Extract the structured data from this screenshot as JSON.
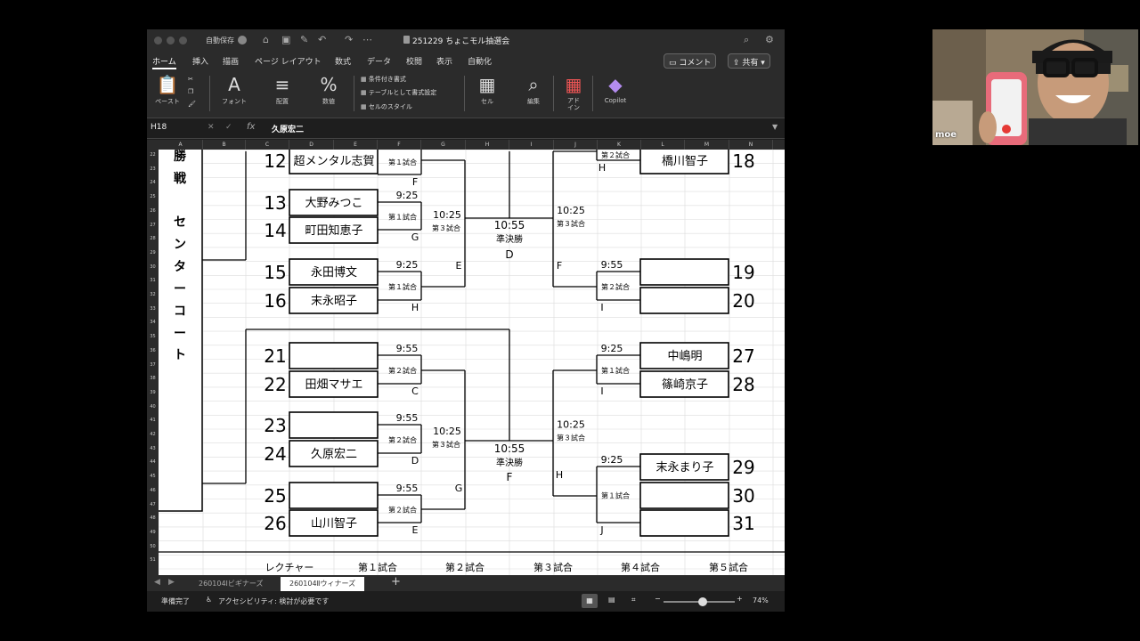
{
  "window": {
    "autosave_label": "自動保存",
    "title": "251229 ちょこモル抽選会"
  },
  "ribbon_tabs": [
    "ホーム",
    "挿入",
    "描画",
    "ページ レイアウト",
    "数式",
    "データ",
    "校閲",
    "表示",
    "自動化"
  ],
  "comment_button": "コメント",
  "share_button": "共有",
  "ribbon": {
    "paste": "ペースト",
    "font": "フォント",
    "align": "配置",
    "number": "数値",
    "cond_format": "条件付き書式",
    "table_format": "テーブルとして書式設定",
    "cell_style": "セルのスタイル",
    "cell": "セル",
    "edit": "編集",
    "addin": "アド\nイン",
    "copilot": "Copilot"
  },
  "formula_bar": {
    "name_box": "H18",
    "fx": "fx",
    "value": "久原宏二"
  },
  "columns": [
    "A",
    "B",
    "C",
    "D",
    "E",
    "F",
    "G",
    "H",
    "I",
    "J",
    "K",
    "L",
    "M",
    "N"
  ],
  "rows": [
    "22",
    "23",
    "24",
    "25",
    "26",
    "27",
    "28",
    "29",
    "30",
    "31",
    "32",
    "33",
    "34",
    "35",
    "36",
    "37",
    "38",
    "39",
    "40",
    "41",
    "42",
    "43",
    "44",
    "45",
    "46",
    "47",
    "48",
    "49",
    "50",
    "51"
  ],
  "sheet": {
    "court_label": [
      "勝",
      "戦",
      "",
      "セ",
      "ン",
      "タ",
      "ー",
      "コ",
      "ー",
      "ト"
    ],
    "left_players": [
      {
        "num": "12",
        "name": "超メンタル志賀"
      },
      {
        "num": "13",
        "name": "大野みつこ"
      },
      {
        "num": "14",
        "name": "町田知恵子"
      },
      {
        "num": "15",
        "name": "永田博文"
      },
      {
        "num": "16",
        "name": "末永昭子"
      },
      {
        "num": "21",
        "name": ""
      },
      {
        "num": "22",
        "name": "田畑マサエ"
      },
      {
        "num": "23",
        "name": ""
      },
      {
        "num": "24",
        "name": "久原宏二"
      },
      {
        "num": "25",
        "name": ""
      },
      {
        "num": "26",
        "name": "山川智子"
      }
    ],
    "right_players": [
      {
        "num": "18",
        "name": "橋川智子"
      },
      {
        "num": "19",
        "name": ""
      },
      {
        "num": "20",
        "name": ""
      },
      {
        "num": "27",
        "name": "中嶋明"
      },
      {
        "num": "28",
        "name": "篠崎京子"
      },
      {
        "num": "29",
        "name": "末永まり子"
      },
      {
        "num": "30",
        "name": ""
      },
      {
        "num": "31",
        "name": ""
      }
    ],
    "match_labels": {
      "m1": "第１試合",
      "m2": "第２試合",
      "m3": "第３試合",
      "semi": "準決勝",
      "t925": "9:25",
      "t955": "9:55",
      "t1025": "10:25",
      "t1055": "10:55"
    },
    "courts": {
      "c": "C",
      "d": "D",
      "e": "E",
      "f": "F",
      "g": "G",
      "h": "H",
      "i": "I",
      "j": "J"
    },
    "footer": [
      "レクチャー",
      "第１試合",
      "第２試合",
      "第３試合",
      "第４試合",
      "第５試合"
    ]
  },
  "sheet_tabs": [
    "260104Ⅰビギナーズ",
    "260104Ⅱウィナーズ"
  ],
  "status": {
    "ready": "準備完了",
    "accessibility": "アクセシビリティ: 検討が必要です",
    "zoom": "74%",
    "zoom_fraction": 0.55
  },
  "webcam": {
    "name": "moe"
  }
}
